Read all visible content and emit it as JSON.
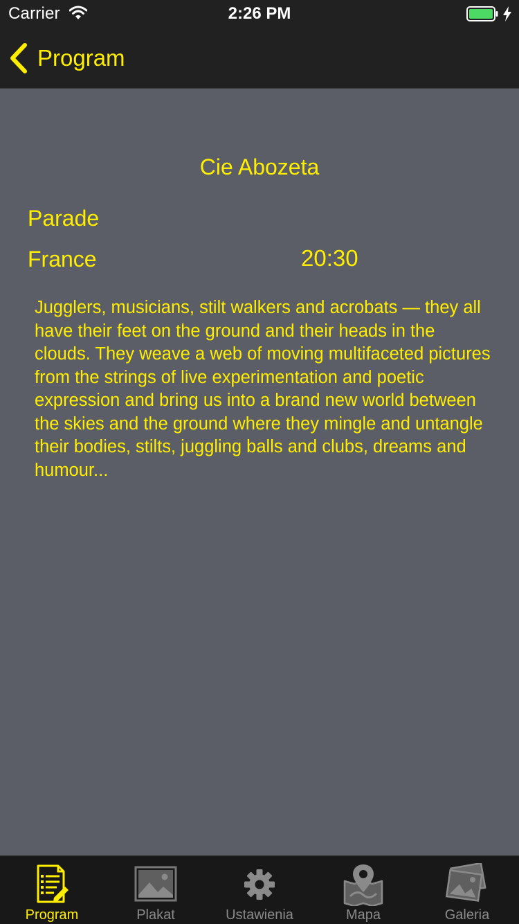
{
  "status_bar": {
    "carrier": "Carrier",
    "time": "2:26 PM",
    "battery_color": "#4cd964"
  },
  "nav": {
    "back_label": "Program",
    "back_icon": "chevron-left-icon",
    "accent_color": "#ffee00"
  },
  "event": {
    "artist": "Cie Abozeta",
    "category": "Parade",
    "country": "France",
    "time": "20:30",
    "description": "Jugglers, musicians, stilt walkers and acrobats — they all have their feet on the ground and their heads in the clouds. They weave a web of moving multifaceted pictures from the strings of live experimentation and poetic expression and bring us into a brand new world between the skies and the ground where they mingle and untangle their bodies, stilts, juggling balls and clubs, dreams and humour..."
  },
  "tabs": [
    {
      "label": "Program",
      "icon": "program-list-icon",
      "active": true
    },
    {
      "label": "Plakat",
      "icon": "poster-image-icon",
      "active": false
    },
    {
      "label": "Ustawienia",
      "icon": "gear-icon",
      "active": false
    },
    {
      "label": "Mapa",
      "icon": "map-pin-icon",
      "active": false
    },
    {
      "label": "Galeria",
      "icon": "gallery-icon",
      "active": false
    }
  ]
}
